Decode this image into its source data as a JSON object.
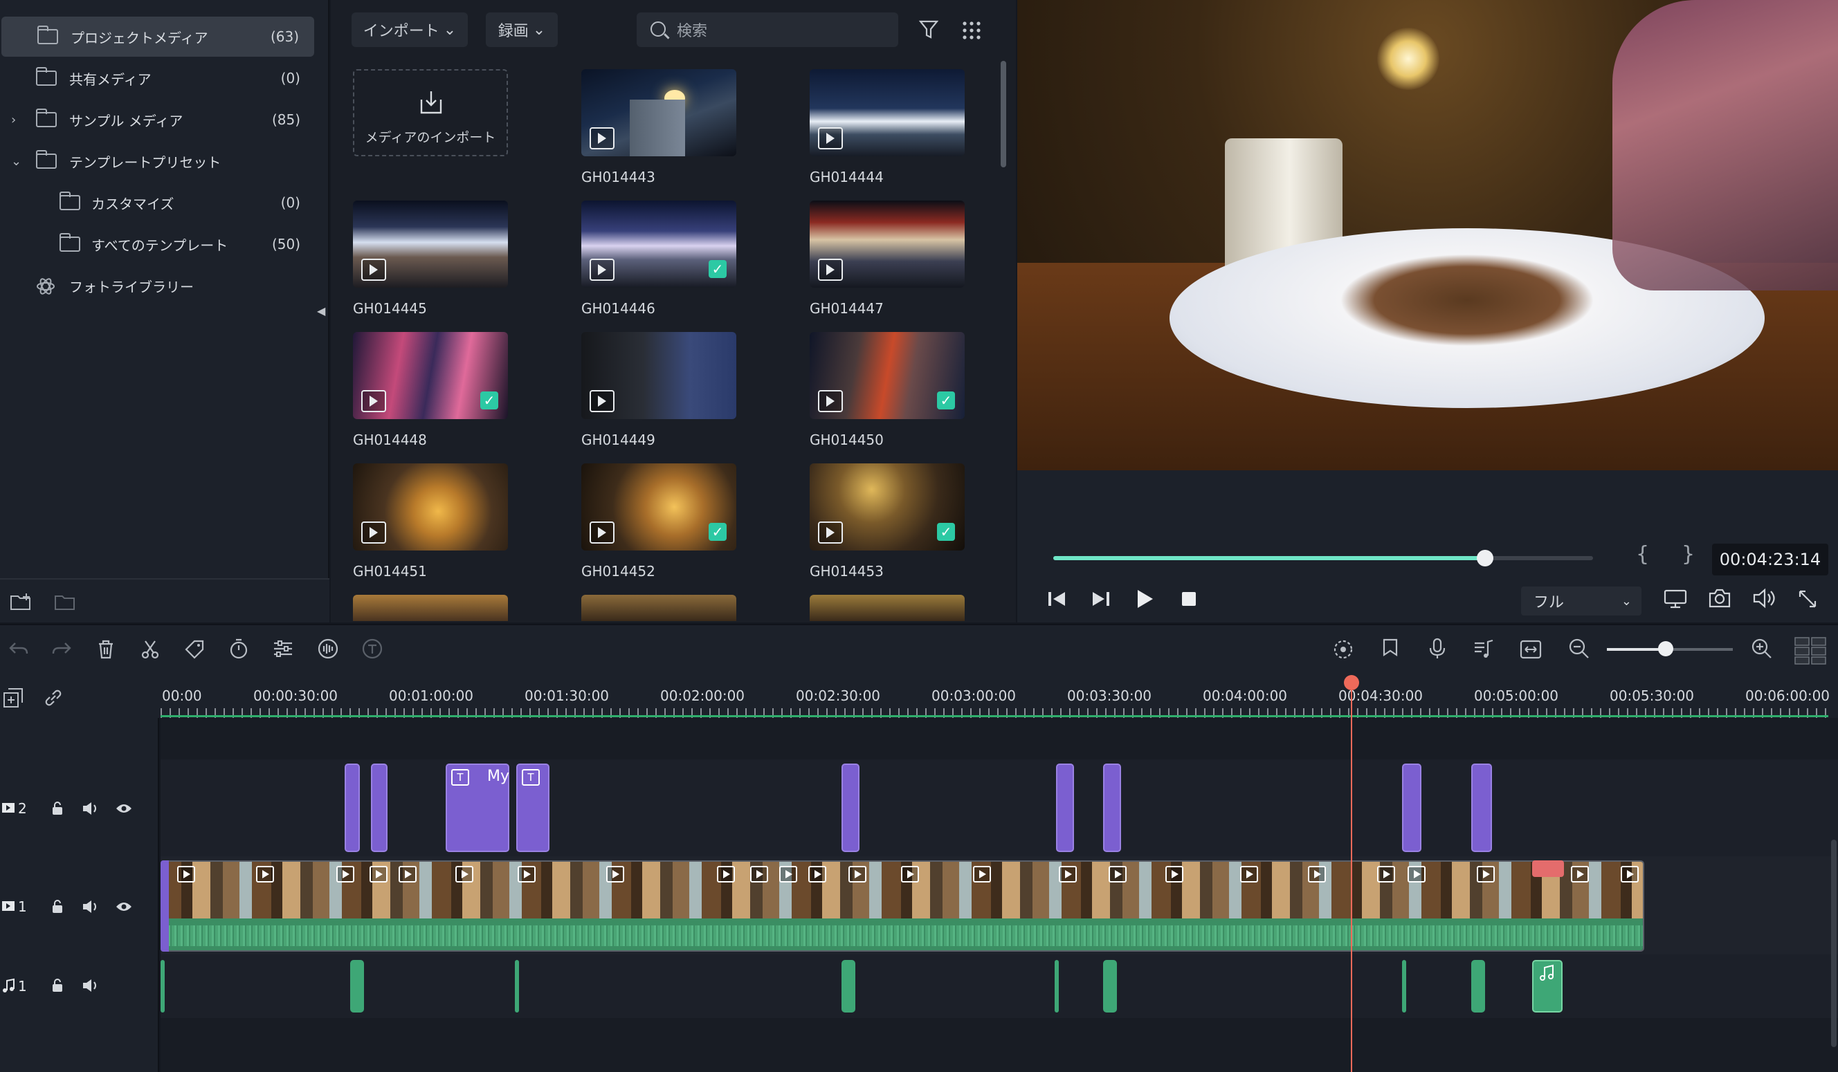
{
  "sidebar": {
    "items": [
      {
        "label": "プロジェクトメディア",
        "count": "(63)"
      },
      {
        "label": "共有メディア",
        "count": "(0)"
      },
      {
        "label": "サンプル メディア",
        "count": "(85)"
      },
      {
        "label": "テンプレートプリセット",
        "count": ""
      },
      {
        "label": "カスタマイズ",
        "count": "(0)"
      },
      {
        "label": "すべてのテンプレート",
        "count": "(50)"
      },
      {
        "label": "フォトライブラリー",
        "count": ""
      }
    ],
    "collapse_glyph": "◀"
  },
  "media_toolbar": {
    "import_label": "インポート",
    "record_label": "録画",
    "search_placeholder": "検索",
    "filter_icon": "filter-icon",
    "grid_icon": "grid-view-icon"
  },
  "media": {
    "import_tile_label": "メディアのインポート",
    "clips": [
      {
        "name": "GH014443",
        "checked": false
      },
      {
        "name": "GH014444",
        "checked": false
      },
      {
        "name": "GH014445",
        "checked": false
      },
      {
        "name": "GH014446",
        "checked": true
      },
      {
        "name": "GH014447",
        "checked": false
      },
      {
        "name": "GH014448",
        "checked": true
      },
      {
        "name": "GH014449",
        "checked": false
      },
      {
        "name": "GH014450",
        "checked": true
      },
      {
        "name": "GH014451",
        "checked": false
      },
      {
        "name": "GH014452",
        "checked": true
      },
      {
        "name": "GH014453",
        "checked": true
      }
    ]
  },
  "player": {
    "timecode": "00:04:23:14",
    "progress": 0.8,
    "mark_in": "{",
    "mark_out": "}",
    "quality": "フル",
    "accent_color": "#6fe6c7"
  },
  "timeline": {
    "ruler_labels": [
      "00:00",
      "00:00:30:00",
      "00:01:00:00",
      "00:01:30:00",
      "00:02:00:00",
      "00:02:30:00",
      "00:03:00:00",
      "00:03:30:00",
      "00:04:00:00",
      "00:04:30:00",
      "00:05:00:00",
      "00:05:30:00",
      "00:06:00:00"
    ],
    "tracks": [
      {
        "label": "2",
        "type": "video"
      },
      {
        "label": "1",
        "type": "video"
      },
      {
        "label": "1",
        "type": "audio"
      }
    ],
    "title_clip_text": "My",
    "title_icon_text": "T",
    "playhead_color": "#ee6a5a",
    "clip_colors": {
      "title": "#7b5fd0",
      "audio": "#3ea776"
    }
  }
}
